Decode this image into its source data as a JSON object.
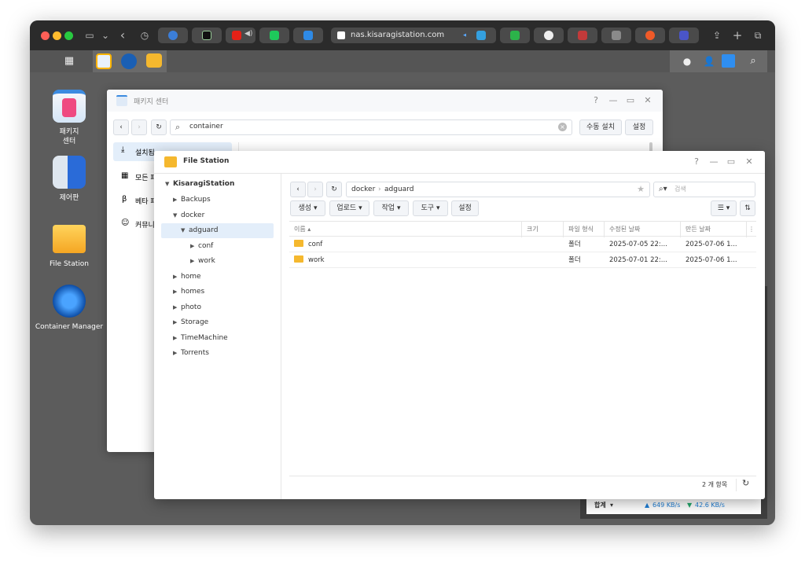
{
  "browser": {
    "url": "nas.kisaragistation.com"
  },
  "desktop": {
    "icons": [
      {
        "label_line1": "패키지",
        "label_line2": "센터"
      },
      {
        "label_line1": "제어판",
        "label_line2": ""
      },
      {
        "label_line1": "File Station",
        "label_line2": ""
      },
      {
        "label_line1": "Container Manager",
        "label_line2": ""
      }
    ]
  },
  "package_center": {
    "title": "패키지 센터",
    "search_value": "container",
    "manual_install": "수동 설치",
    "settings": "설정",
    "sidebar": [
      {
        "label": "설치됨"
      },
      {
        "label": "모든 패"
      },
      {
        "label": "베타 패"
      },
      {
        "label": "커뮤니"
      }
    ]
  },
  "file_station": {
    "title": "File Station",
    "root": "KisaragiStation",
    "tree": [
      {
        "label": "Backups"
      },
      {
        "label": "docker"
      },
      {
        "label": "adguard"
      },
      {
        "label": "conf"
      },
      {
        "label": "work"
      },
      {
        "label": "home"
      },
      {
        "label": "homes"
      },
      {
        "label": "photo"
      },
      {
        "label": "Storage"
      },
      {
        "label": "TimeMachine"
      },
      {
        "label": "Torrents"
      }
    ],
    "path": [
      "docker",
      "adguard"
    ],
    "search_placeholder": "검색",
    "toolbar": {
      "create": "생성",
      "upload": "업로드",
      "action": "작업",
      "tools": "도구",
      "settings": "설정"
    },
    "columns": {
      "name": "이름",
      "size": "크기",
      "type": "파일 형식",
      "modified": "수정된 날짜",
      "created": "만든 날짜"
    },
    "rows": [
      {
        "name": "conf",
        "size": "",
        "type": "폴더",
        "modified": "2025-07-05 22:...",
        "created": "2025-07-06 1..."
      },
      {
        "name": "work",
        "size": "",
        "type": "폴더",
        "modified": "2025-07-01 22:...",
        "created": "2025-07-06 1..."
      }
    ],
    "item_count": "2 개 항목"
  },
  "resource_monitor": {
    "total_label": "합계",
    "upload": "649 KB/s",
    "download": "42.6 KB/s"
  },
  "colors": {
    "accent": "#1f7fd6",
    "folder": "#f5b82e",
    "selected_row": "#e3eefa"
  }
}
